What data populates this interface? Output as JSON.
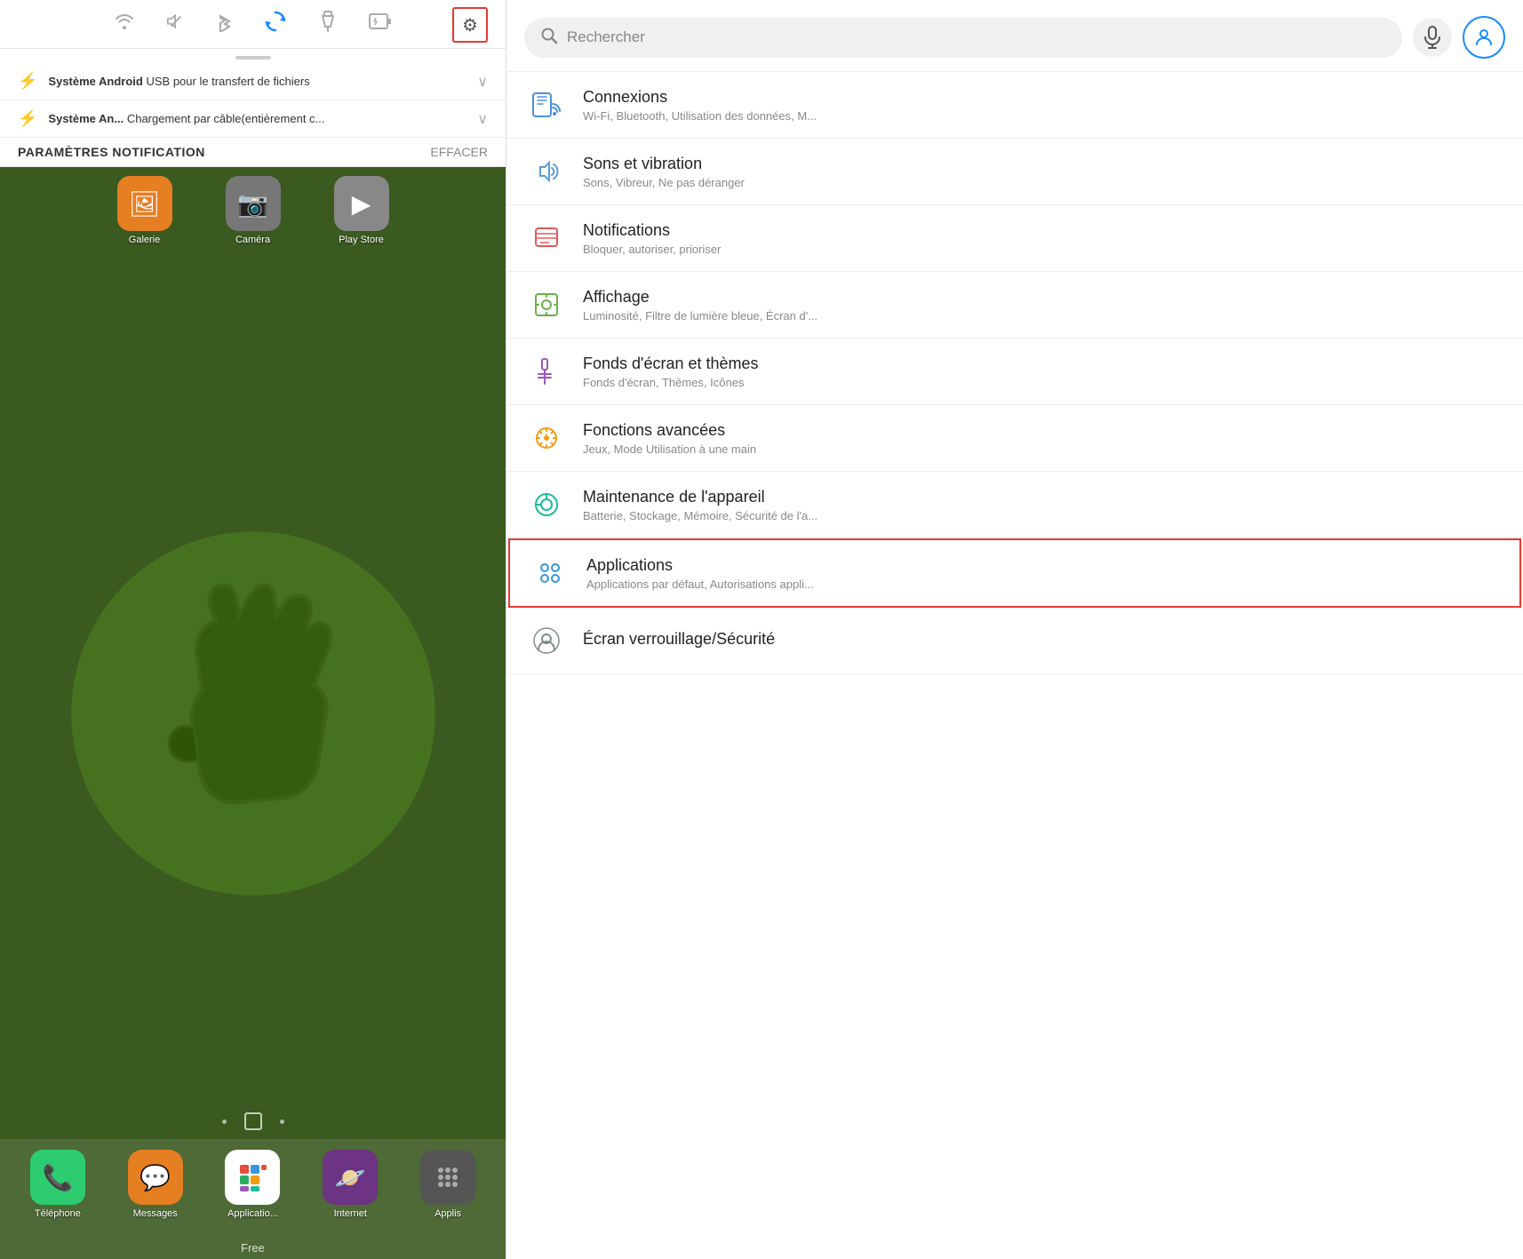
{
  "left": {
    "status_icons": [
      "wifi",
      "mute",
      "bluetooth",
      "sync",
      "flashlight",
      "battery"
    ],
    "gear_label": "⚙",
    "notifications": [
      {
        "icon": "⚡",
        "title": "Système Android",
        "detail": "USB pour le transfert de fichiers",
        "has_arrow": true
      },
      {
        "icon": "⚡",
        "title": "Système An...",
        "detail": "Chargement par câble(entièrement c...",
        "has_arrow": true
      }
    ],
    "notification_header": "PARAMÈTRES NOTIFICATION",
    "clear_label": "EFFACER",
    "apps_top": [
      {
        "label": "Galerie",
        "color": "#e67e22",
        "icon": "🖼"
      },
      {
        "label": "Caméra",
        "color": "#888",
        "icon": "📷"
      },
      {
        "label": "Play Store",
        "color": "#888",
        "icon": "▶"
      }
    ],
    "dock_apps": [
      {
        "label": "Téléphone",
        "color": "#2ecc71",
        "icon": "📞"
      },
      {
        "label": "Messages",
        "color": "#e67e22",
        "icon": "💬"
      },
      {
        "label": "Applicatio...",
        "color": "#fff",
        "icon": "⊞"
      },
      {
        "label": "Internet",
        "color": "#6c3483",
        "icon": "🪐"
      },
      {
        "label": "Applis",
        "color": "#555",
        "icon": "⋯"
      }
    ],
    "carrier": "Free"
  },
  "right": {
    "search_placeholder": "Rechercher",
    "settings_items": [
      {
        "id": "connexions",
        "title": "Connexions",
        "subtitle": "Wi-Fi, Bluetooth, Utilisation des données, M...",
        "highlighted": false
      },
      {
        "id": "sons",
        "title": "Sons et vibration",
        "subtitle": "Sons, Vibreur, Ne pas déranger",
        "highlighted": false
      },
      {
        "id": "notifications",
        "title": "Notifications",
        "subtitle": "Bloquer, autoriser, prioriser",
        "highlighted": false
      },
      {
        "id": "affichage",
        "title": "Affichage",
        "subtitle": "Luminosité, Filtre de lumière bleue, Écran d'...",
        "highlighted": false
      },
      {
        "id": "fonds",
        "title": "Fonds d'écran et thèmes",
        "subtitle": "Fonds d'écran, Thèmes, Icônes",
        "highlighted": false
      },
      {
        "id": "fonctions",
        "title": "Fonctions avancées",
        "subtitle": "Jeux, Mode Utilisation à une main",
        "highlighted": false
      },
      {
        "id": "maintenance",
        "title": "Maintenance de l'appareil",
        "subtitle": "Batterie, Stockage, Mémoire, Sécurité de l'a...",
        "highlighted": false
      },
      {
        "id": "applications",
        "title": "Applications",
        "subtitle": "Applications par défaut, Autorisations appli...",
        "highlighted": true
      },
      {
        "id": "ecran",
        "title": "Écran verrouillage/Sécurité",
        "subtitle": "",
        "highlighted": false
      }
    ]
  }
}
